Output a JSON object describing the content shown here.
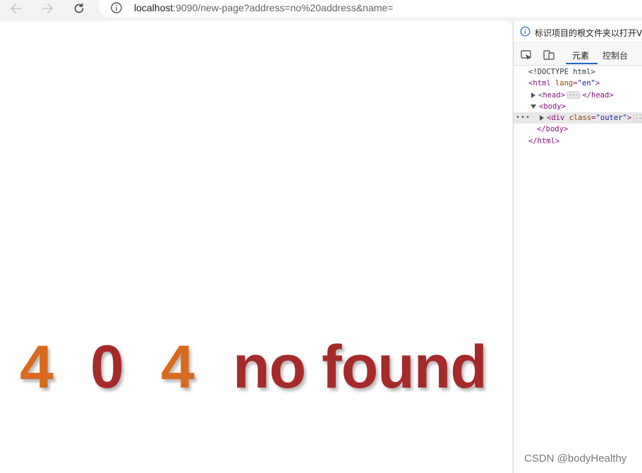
{
  "browser": {
    "url_host": "localhost",
    "url_rest": ":9090/new-page?address=no%20address&name="
  },
  "page": {
    "digit_1": "4",
    "digit_2": "0",
    "digit_3": "4",
    "message": "no found"
  },
  "devtools": {
    "banner_text": "标识项目的根文件夹以打开V",
    "tabs": [
      "元素",
      "控制台"
    ],
    "dom": {
      "doctype": "<!DOCTYPE html>",
      "html_open_tag": "<html",
      "html_attr": "lang",
      "html_attr_val": "\"en\"",
      "head_open": "<head>",
      "head_close": "</head>",
      "body_open": "<body>",
      "div_open": "<div",
      "div_attr": "class",
      "div_attr_val": "\"outer\"",
      "body_close": "</body>",
      "html_close": "</html>",
      "ellipsis": "···",
      "gutter": "•••"
    }
  },
  "watermark": "CSDN @bodyHealthy",
  "colors": {
    "orange_digit": "#d86a1f",
    "red_text": "#a52a2a",
    "devtools_accent": "#1b6ac9"
  }
}
